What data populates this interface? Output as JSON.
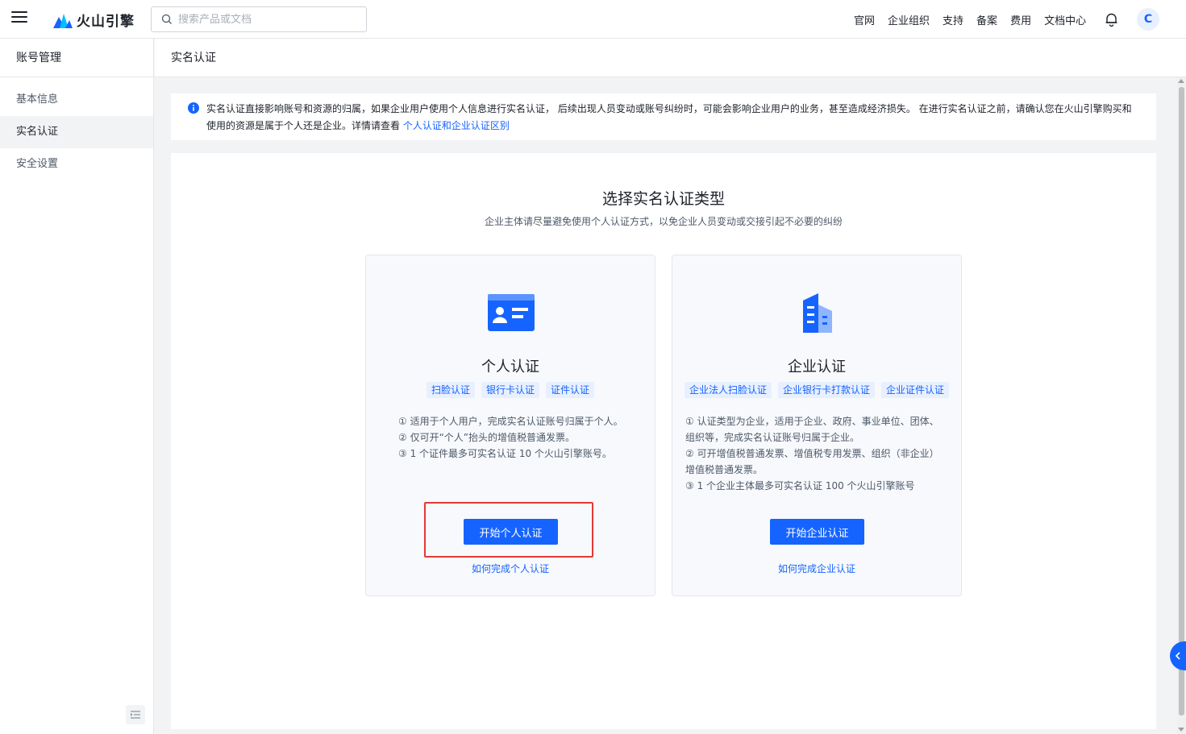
{
  "topbar": {
    "brand": "火山引擎",
    "search_placeholder": "搜索产品或文档",
    "nav": [
      "官网",
      "企业组织",
      "支持",
      "备案",
      "费用",
      "文档中心"
    ],
    "avatar_letter": "C"
  },
  "sidebar": {
    "title": "账号管理",
    "items": [
      {
        "label": "基本信息"
      },
      {
        "label": "实名认证"
      },
      {
        "label": "安全设置"
      }
    ]
  },
  "main": {
    "header_title": "实名认证",
    "alert": {
      "text": "实名认证直接影响账号和资源的归属，如果企业用户使用个人信息进行实名认证， 后续出现人员变动或账号纠纷时，可能会影响企业用户的业务，甚至造成经济损失。 在进行实名认证之前，请确认您在火山引擎购买和使用的资源是属于个人还是企业。详情请查看 ",
      "link": "个人认证和企业认证区别"
    },
    "title": "选择实名认证类型",
    "subtitle": "企业主体请尽量避免使用个人认证方式，以免企业人员变动或交接引起不必要的纠纷",
    "personal": {
      "title": "个人认证",
      "tags": [
        "扫脸认证",
        "银行卡认证",
        "证件认证"
      ],
      "desc": [
        "① 适用于个人用户，完成实名认证账号归属于个人。",
        "② 仅可开“个人”抬头的增值税普通发票。",
        "③ 1 个证件最多可实名认证 10 个火山引擎账号。"
      ],
      "button": "开始个人认证",
      "link": "如何完成个人认证"
    },
    "enterprise": {
      "title": "企业认证",
      "tags": [
        "企业法人扫脸认证",
        "企业银行卡打款认证",
        "企业证件认证"
      ],
      "desc": [
        "① 认证类型为企业，适用于企业、政府、事业单位、团体、",
        "组织等，完成实名认证账号归属于企业。",
        "② 可开增值税普通发票、增值税专用发票、组织（非企业）",
        "增值税普通发票。",
        "③ 1 个企业主体最多可实名认证 100 个火山引擎账号"
      ],
      "button": "开始企业认证",
      "link": "如何完成企业认证"
    }
  },
  "colors": {
    "accent": "#1664ff",
    "highlight": "#e53935"
  }
}
